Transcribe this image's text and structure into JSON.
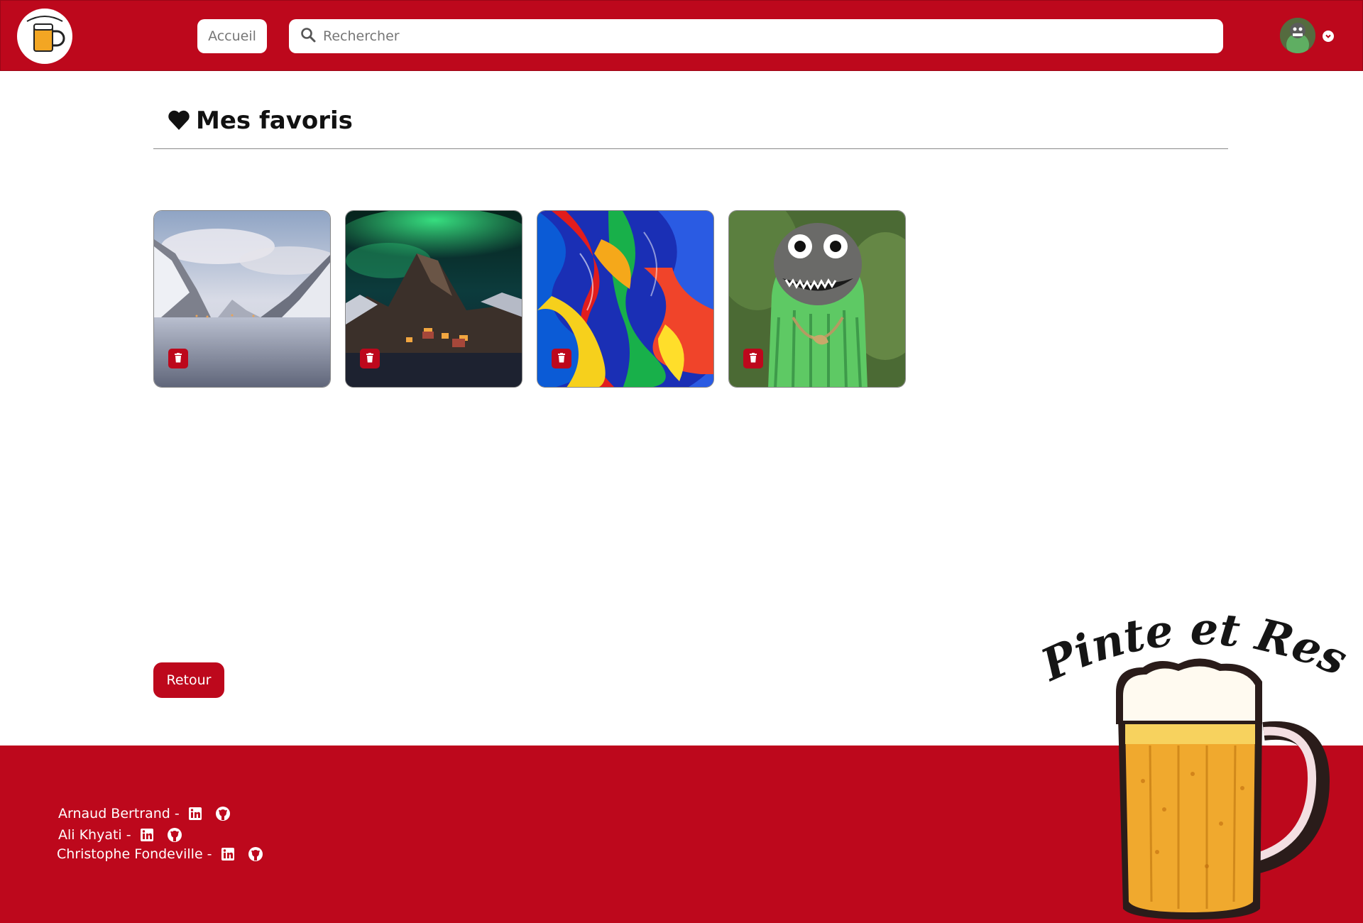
{
  "header": {
    "home_label": "Accueil",
    "search_placeholder": "Rechercher",
    "brand_color": "#bd081c"
  },
  "main": {
    "title": "Mes favoris",
    "title_icon": "heart-icon",
    "favorites": [
      {
        "subject": "snowy fjord with mountains and reflection",
        "action_icon": "trash-icon"
      },
      {
        "subject": "aurora borealis over mountain village",
        "action_icon": "trash-icon"
      },
      {
        "subject": "colorful marbled abstract paint",
        "action_icon": "trash-icon"
      },
      {
        "subject": "carved wooden monster sculpture",
        "action_icon": "trash-icon"
      }
    ],
    "back_label": "Retour"
  },
  "footer": {
    "credits": [
      {
        "name": "Arnaud Bertrand -",
        "icons": [
          "linkedin-icon",
          "github-icon"
        ]
      },
      {
        "name": "Ali Khyati -",
        "icons": [
          "linkedin-icon",
          "github-icon"
        ]
      },
      {
        "name": "Christophe Fondeville -",
        "icons": [
          "linkedin-icon",
          "github-icon"
        ]
      }
    ],
    "brand_mascot_text": "Pinte et Reste"
  }
}
